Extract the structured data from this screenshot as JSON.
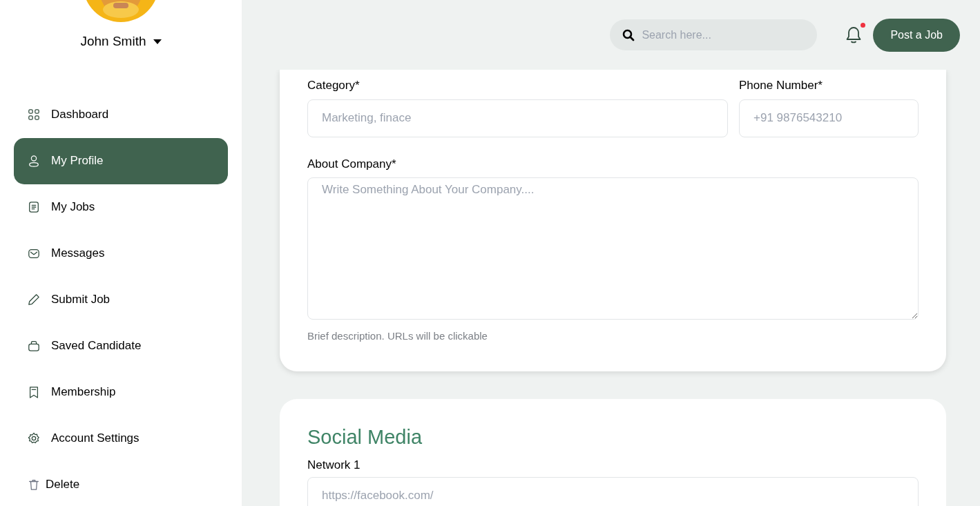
{
  "user": {
    "name": "John Smith"
  },
  "sidebar": {
    "items": [
      {
        "label": "Dashboard",
        "selected": false,
        "kind": "nav"
      },
      {
        "label": "My Profile",
        "selected": true,
        "kind": "nav"
      },
      {
        "label": "My Jobs",
        "selected": false,
        "kind": "nav"
      },
      {
        "label": "Messages",
        "selected": false,
        "kind": "nav"
      },
      {
        "label": "Submit Job",
        "selected": false,
        "kind": "nav"
      },
      {
        "label": "Saved Candidate",
        "selected": false,
        "kind": "nav"
      },
      {
        "label": "Membership",
        "selected": false,
        "kind": "nav"
      },
      {
        "label": "Account Settings",
        "selected": false,
        "kind": "nav"
      },
      {
        "label": "Delete",
        "selected": false,
        "kind": "action"
      }
    ]
  },
  "header": {
    "search": {
      "placeholder": "Search here..."
    },
    "notifications": {
      "unread": true
    },
    "post_button": "Post a Job"
  },
  "company_card": {
    "fields": [
      {
        "label": "Category*",
        "placeholder": "Marketing, finace"
      },
      {
        "label": "Phone Number*",
        "placeholder": "+91 9876543210"
      }
    ],
    "about": {
      "label": "About Company*",
      "placeholder": "Write Something About Your Company....",
      "help": "Brief description. URLs will be clickable"
    }
  },
  "social_card": {
    "title": "Social Media",
    "fields": [
      {
        "label": "Network 1",
        "placeholder": "https://facebook.com/"
      }
    ]
  }
}
